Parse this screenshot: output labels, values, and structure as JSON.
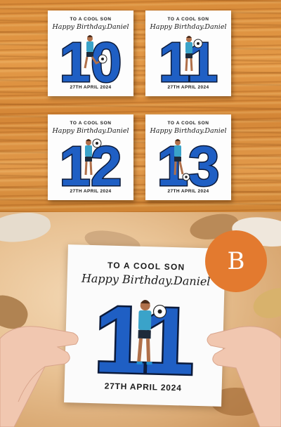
{
  "cards": [
    {
      "line1": "TO A COOL SON",
      "line2": "Happy Birthday.Daniel",
      "number": "10",
      "date": "27TH APRIL 2024"
    },
    {
      "line1": "TO A COOL SON",
      "line2": "Happy Birthday.Daniel",
      "number": "11",
      "date": "27TH APRIL 2024"
    },
    {
      "line1": "TO A COOL SON",
      "line2": "Happy Birthday.Daniel",
      "number": "12",
      "date": "27TH APRIL 2024"
    },
    {
      "line1": "TO A COOL SON",
      "line2": "Happy Birthday.Daniel",
      "number": "13",
      "date": "27TH APRIL 2024"
    }
  ],
  "featured_card": {
    "line1": "TO A COOL SON",
    "line2": "Happy Birthday.Daniel",
    "number": "11",
    "date": "27TH APRIL 2024"
  },
  "badge": {
    "label": "B"
  },
  "colors": {
    "number_fill": "#1f5fc4",
    "number_outline": "#0b1a3a",
    "badge": "#e37a2f",
    "player_shirt": "#3aa3c9",
    "player_shorts": "#1e2a3a",
    "player_skin": "#b0704a",
    "player_hair": "#4a2a18"
  },
  "icons": [
    "soccer-ball-icon",
    "football-player-illustration"
  ]
}
